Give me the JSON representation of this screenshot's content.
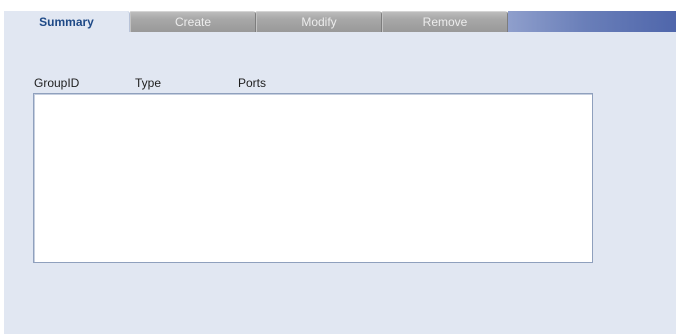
{
  "tabs": [
    {
      "label": "Summary",
      "active": true
    },
    {
      "label": "Create",
      "active": false
    },
    {
      "label": "Modify",
      "active": false
    },
    {
      "label": "Remove",
      "active": false
    }
  ],
  "table": {
    "columns": [
      "GroupID",
      "Type",
      "Ports"
    ],
    "rows": []
  },
  "colors": {
    "panel_background": "#e1e7f2",
    "active_tab_text": "#1f4a87",
    "inactive_tab_background": "#a8a8a8",
    "tab_bar_accent": "#6a7fb9",
    "list_border": "#8fa0bd"
  }
}
